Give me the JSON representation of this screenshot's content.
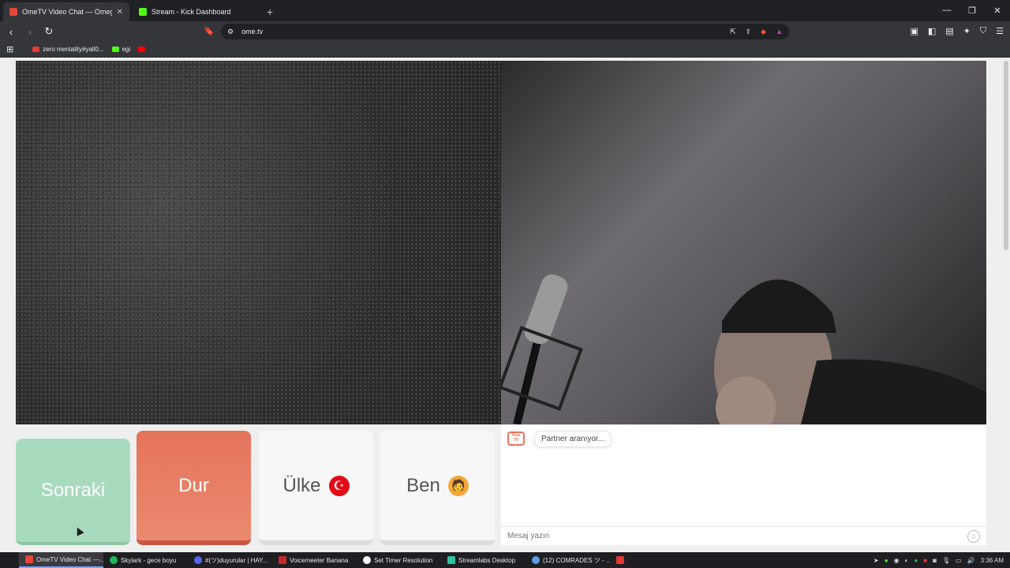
{
  "browser": {
    "tabs": [
      {
        "title": "OmeTV Video Chat — Omeg",
        "active": true,
        "favicon_color": "#e5473b"
      },
      {
        "title": "Stream - Kick Dashboard",
        "active": false,
        "favicon_color": "#53fc18"
      }
    ],
    "new_tab": "+",
    "url": "ome.tv",
    "bookmarks": [
      {
        "label": "zero mentality#yall0...",
        "color": "#e53935"
      },
      {
        "label": "egi",
        "color": "#53fc18"
      },
      {
        "label": "",
        "color": "#ff0000"
      }
    ]
  },
  "controls": {
    "next_label": "Sonraki",
    "stop_label": "Dur",
    "country_label": "Ülke",
    "country_flag": "☪",
    "me_label": "Ben",
    "me_icon": "🧑"
  },
  "chat": {
    "logo_text": "Ome TV",
    "status_message": "Partner aranıyor...",
    "input_placeholder": "Mesaj yazın"
  },
  "taskbar": {
    "items": [
      {
        "label": "OmeTV Video Chat —...",
        "color": "#e5473b",
        "active": true
      },
      {
        "label": "Skylark - gece boyu",
        "color": "#1db954",
        "active": false
      },
      {
        "label": "#(ツ)duyurular | HAY...",
        "color": "#5865f2",
        "active": false
      },
      {
        "label": "Voicemeeter Banana",
        "color": "#c62828",
        "active": false
      },
      {
        "label": "Set Timer Resolution",
        "color": "#ffffff",
        "active": false
      },
      {
        "label": "Streamlabs Desktop",
        "color": "#31c3a2",
        "active": false
      },
      {
        "label": "(12) COMRADES ツ - ...",
        "color": "#5c9ce6",
        "active": false
      },
      {
        "label": "",
        "color": "#e53935",
        "active": false
      }
    ],
    "clock": "3:36 AM"
  }
}
